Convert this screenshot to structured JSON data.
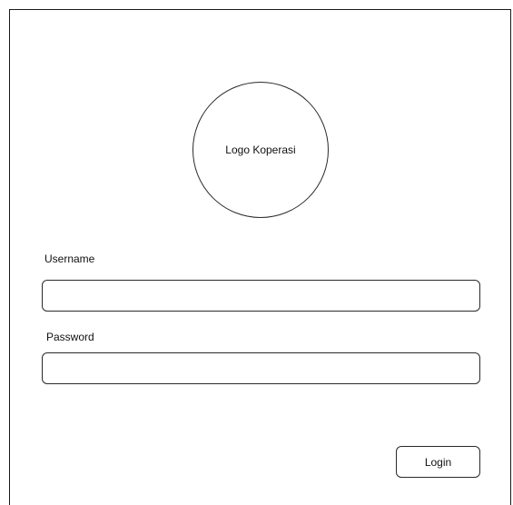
{
  "logo": {
    "text": "Logo Koperasi"
  },
  "form": {
    "username_label": "Username",
    "username_value": "",
    "username_placeholder": "",
    "password_label": "Password",
    "password_value": "",
    "password_placeholder": "",
    "login_label": "Login"
  }
}
